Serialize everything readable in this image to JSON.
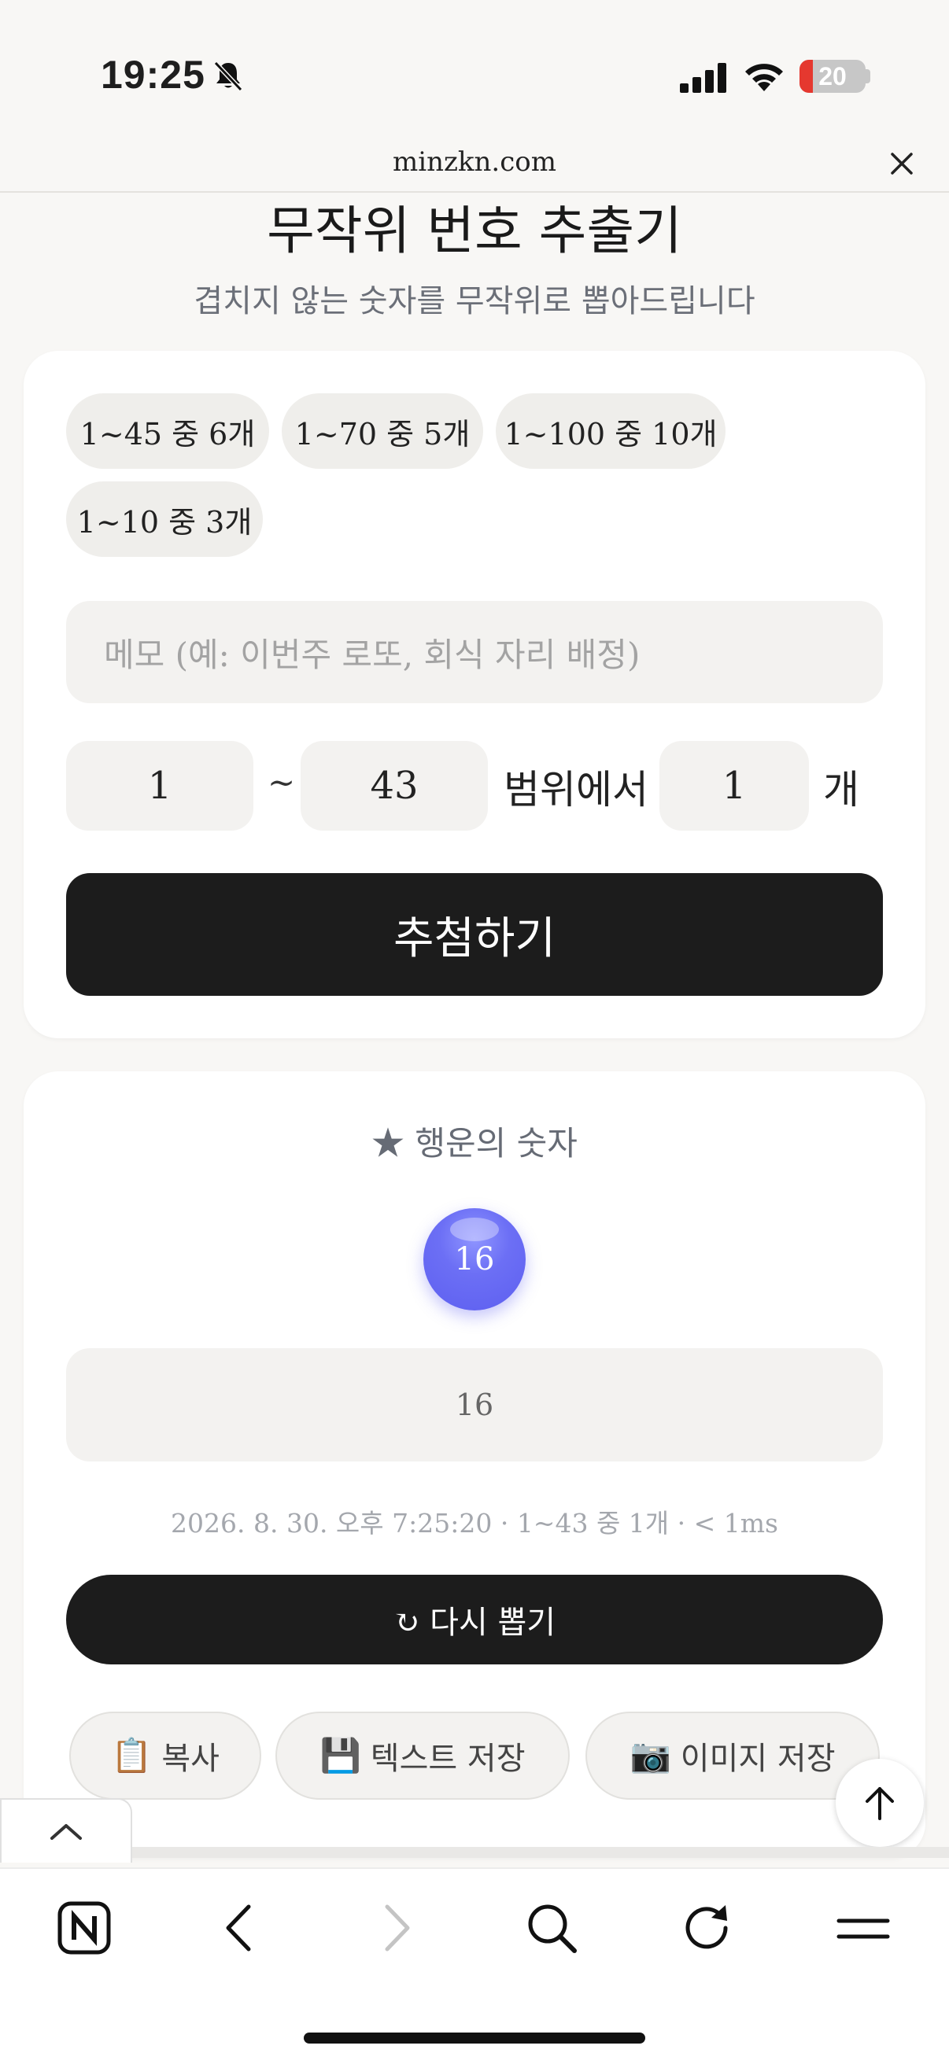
{
  "status_bar": {
    "time": "19:25",
    "battery_level": 20,
    "battery_text": "20",
    "icons": [
      "bell-slash-icon",
      "signal-icon",
      "wifi-icon",
      "battery-icon"
    ]
  },
  "browser": {
    "url": "minzkn.com",
    "close_icon": "close-icon"
  },
  "page": {
    "title": "무작위 번호 추출기",
    "subtitle": "겹치지 않는 숫자를 무작위로 뽑아드립니다"
  },
  "presets": [
    {
      "label": "1~45 중 6개"
    },
    {
      "label": "1~70 중 5개"
    },
    {
      "label": "1~100 중 10개"
    },
    {
      "label": "1~10 중 3개"
    }
  ],
  "form": {
    "memo_placeholder": "메모 (예: 이번주 로또, 회식 자리 배정)",
    "min_value": "1",
    "separator": "~",
    "max_value": "43",
    "range_label": "범위에서",
    "count_value": "1",
    "count_unit": "개",
    "draw_button": "추첨하기"
  },
  "result": {
    "title": "★ 행운의 숫자",
    "balls": [
      "16"
    ],
    "text": "16",
    "meta": "2026. 8. 30. 오후 7:25:20 · 1~43 중 1개 · < 1ms",
    "redraw_button": "↻ 다시 뽑기",
    "actions": [
      {
        "icon": "📋",
        "label": "복사"
      },
      {
        "icon": "💾",
        "label": "텍스트 저장"
      },
      {
        "icon": "📷",
        "label": "이미지 저장"
      }
    ]
  },
  "colors": {
    "background": "#f8f7f5",
    "primary_button": "#1c1c1c",
    "ball": "#6163f2",
    "chip": "#efeeeb",
    "muted_text": "#6b6f78"
  },
  "toolbar": {
    "icons": [
      "naver-icon",
      "back-icon",
      "forward-icon",
      "search-icon",
      "reload-icon",
      "menu-icon"
    ]
  }
}
